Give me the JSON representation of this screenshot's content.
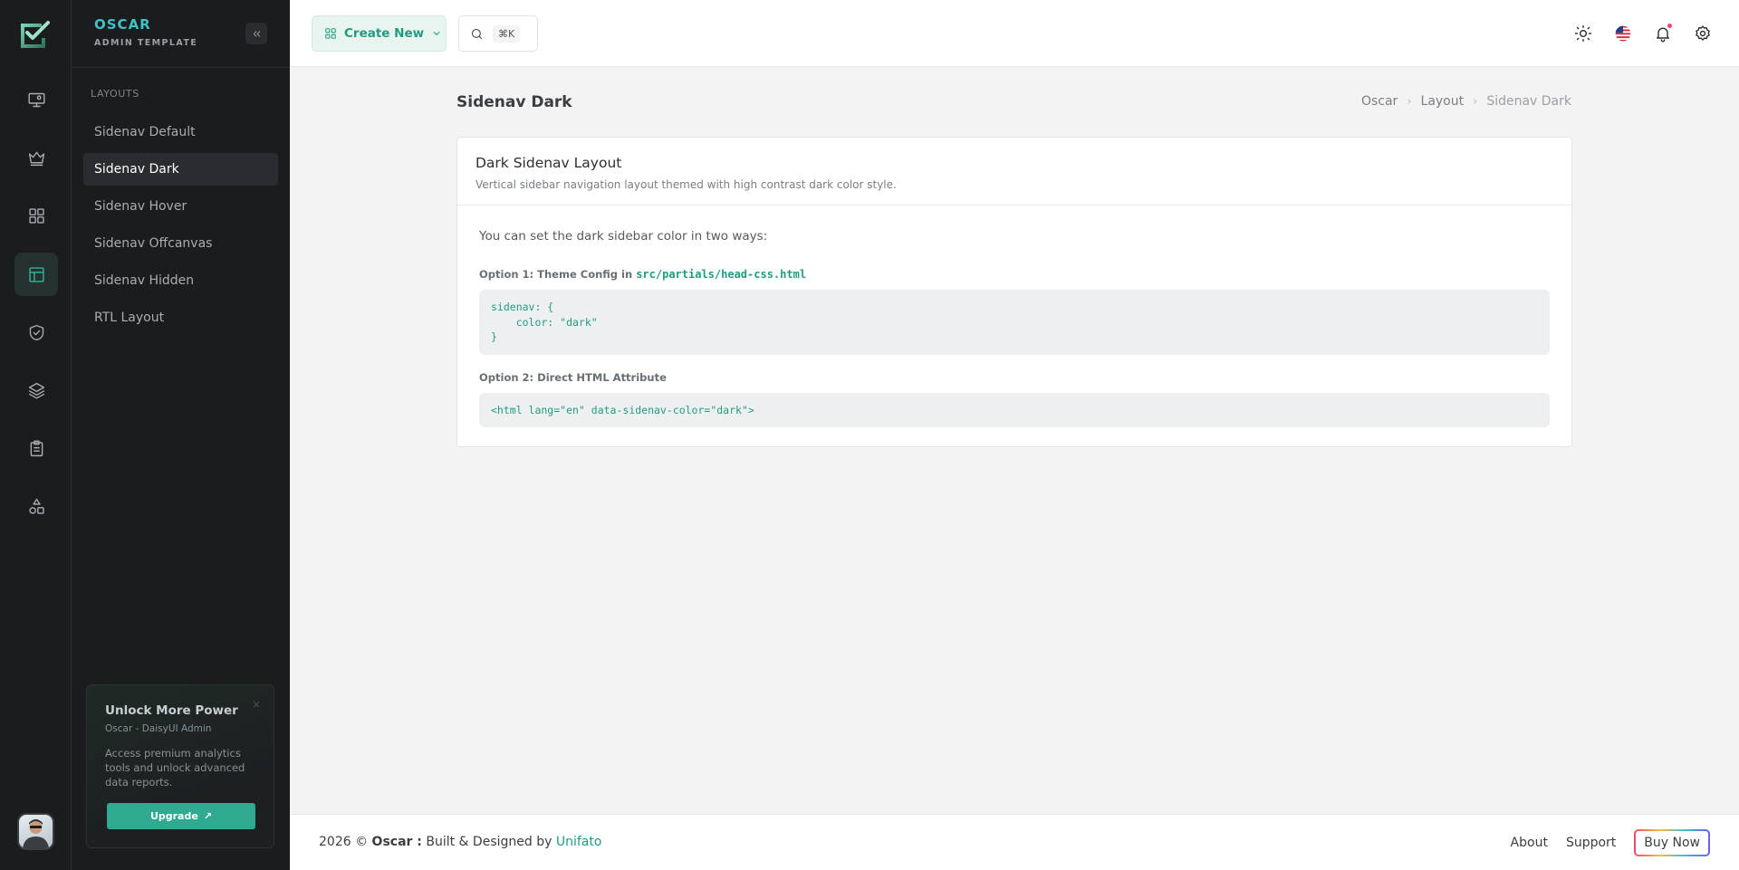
{
  "brand": {
    "name": "OSCAR",
    "subtitle": "ADMIN TEMPLATE"
  },
  "rail": {
    "icons": [
      "monitor-icon",
      "crown-icon",
      "grid-icon",
      "layout-icon",
      "shield-check-icon",
      "layers-icon",
      "clipboard-icon",
      "shapes-icon"
    ],
    "active_index": 3
  },
  "sidebar": {
    "section_title": "LAYOUTS",
    "items": [
      {
        "label": "Sidenav Default"
      },
      {
        "label": "Sidenav Dark"
      },
      {
        "label": "Sidenav Hover"
      },
      {
        "label": "Sidenav Offcanvas"
      },
      {
        "label": "Sidenav Hidden"
      },
      {
        "label": "RTL Layout"
      }
    ],
    "active_index": 1
  },
  "promo": {
    "title": "Unlock More Power",
    "subtitle": "Oscar - DaisyUI Admin",
    "text": "Access premium analytics tools and unlock advanced data reports.",
    "button_label": "Upgrade",
    "button_icon": "↗",
    "close_icon": "×"
  },
  "header": {
    "create_label": "Create New",
    "search_shortcut": "⌘K"
  },
  "page": {
    "title": "Sidenav Dark",
    "breadcrumb": [
      "Oscar",
      "Layout",
      "Sidenav Dark"
    ]
  },
  "card": {
    "title": "Dark Sidenav Layout",
    "description": "Vertical sidebar navigation layout themed with high contrast dark color style.",
    "intro": "You can set the dark sidebar color in two ways:",
    "option1_label": "Option 1: Theme Config in",
    "option1_path": "src/partials/head-css.html",
    "option1_code": "sidenav: {\n    color: \"dark\"\n}",
    "option2_label": "Option 2: Direct HTML Attribute",
    "option2_code": "<html lang=\"en\" data-sidenav-color=\"dark\">"
  },
  "footer": {
    "year_copy": "2026 ©",
    "brand": "Oscar :",
    "built_by": "Built & Designed by",
    "company": "Unifato",
    "links": [
      "About",
      "Support"
    ],
    "buy_label": "Buy Now"
  },
  "colors": {
    "accent": "#229b82",
    "sidebar_bg": "#1b1c1e",
    "brand": "#3fc1c9"
  }
}
